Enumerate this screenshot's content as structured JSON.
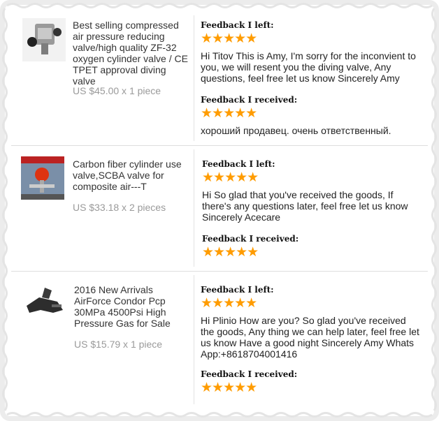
{
  "colors": {
    "star": "#ff9c00",
    "price": "#9a9a9a",
    "border": "#ececec"
  },
  "items": [
    {
      "image_icon": "valve-thumbnail-icon",
      "title": "Best selling compressed air pressure reducing valve/high quality ZF-32 oxygen cylinder valve / CE TPET approval diving valve",
      "price": "US $45.00 x 1 piece",
      "left_label": "Feedback I left:",
      "left_stars": 5,
      "left_text": "Hi Titov This is Amy, I'm sorry for the inconvient to you, we will resent you the diving valve, Any questions, feel free let us know Sincerely Amy",
      "recv_label": "Feedback I received:",
      "recv_stars": 5,
      "recv_text": "хороший продавец. очень ответственный."
    },
    {
      "image_icon": "scba-valve-thumbnail-icon",
      "title": "Carbon fiber cylinder use valve,SCBA valve for composite air---T",
      "price": "US $33.18 x 2 pieces",
      "left_label": "Feedback I left:",
      "left_stars": 5,
      "left_text": "Hi So glad that you've received the goods, If there's any questions later, feel free let us know Sincerely Acecare",
      "recv_label": "Feedback I received:",
      "recv_stars": 5,
      "recv_text": ""
    },
    {
      "image_icon": "air-gun-part-thumbnail-icon",
      "title": "2016 New Arrivals AirForce Condor Pcp 30MPa 4500Psi High Pressure Gas for Sale",
      "price": "US $15.79 x 1 piece",
      "left_label": "Feedback I left:",
      "left_stars": 5,
      "left_text": "Hi Plinio How are you? So glad you've received the goods, Any thing we can help later, feel free let us know Have a good night Sincerely Amy Whats App:+8618704001416",
      "recv_label": "Feedback I received:",
      "recv_stars": 5,
      "recv_text": ""
    }
  ],
  "star_glyph": "★★★★★"
}
